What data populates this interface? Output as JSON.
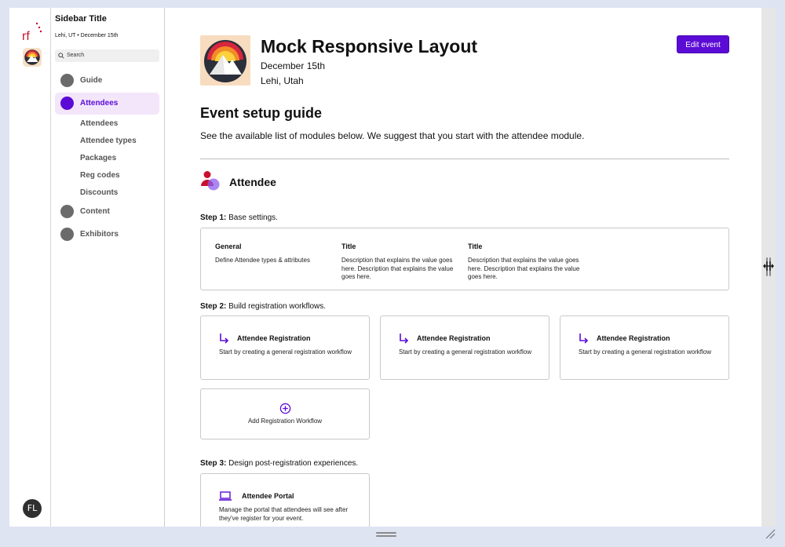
{
  "rail": {
    "logo_text": "rf",
    "avatar_initials": "FL"
  },
  "sidebar": {
    "title": "Sidebar Title",
    "subtitle": "Lehi, UT • December 15th",
    "search_placeholder": "Search",
    "nav": [
      {
        "label": "Guide",
        "active": false
      },
      {
        "label": "Attendees",
        "active": true
      },
      {
        "label": "Content",
        "active": false
      },
      {
        "label": "Exhibitors",
        "active": false
      }
    ],
    "sub_items": [
      "Attendees",
      "Attendee types",
      "Packages",
      "Reg codes",
      "Discounts"
    ]
  },
  "header": {
    "title": "Mock Responsive Layout",
    "date": "December 15th",
    "location": "Lehi, Utah",
    "edit_button": "Edit event"
  },
  "guide": {
    "title": "Event setup guide",
    "description": "See the available list of modules below. We suggest that you start with the attendee module."
  },
  "module": {
    "title": "Attendee",
    "step1": {
      "label": "Step 1:",
      "text": "Base settings.",
      "columns": [
        {
          "title": "General",
          "description": "Define Attendee types & attributes"
        },
        {
          "title": "Title",
          "description": "Description that explains the value goes here. Description that explains the value goes here."
        },
        {
          "title": "Title",
          "description": "Description that explains the value goes here. Description that explains the value goes here."
        }
      ]
    },
    "step2": {
      "label": "Step 2:",
      "text": "Build registration workflows.",
      "cards": [
        {
          "title": "Attendee Registration",
          "description": "Start by creating a general registration workflow"
        },
        {
          "title": "Attendee Registration",
          "description": "Start by creating a general registration workflow"
        },
        {
          "title": "Attendee Registration",
          "description": "Start by creating a general registration workflow"
        }
      ],
      "add_label": "Add Registration Workflow"
    },
    "step3": {
      "label": "Step 3:",
      "text": "Design post-registration experiences.",
      "card": {
        "title": "Attendee Portal",
        "description": "Manage the portal that attendees will see after they've register for your event."
      }
    }
  },
  "colors": {
    "accent": "#5b0bd6",
    "active_bg": "#f3e6fb",
    "nav_dot": "#6b6b6b",
    "logo_red": "#c8102e"
  }
}
